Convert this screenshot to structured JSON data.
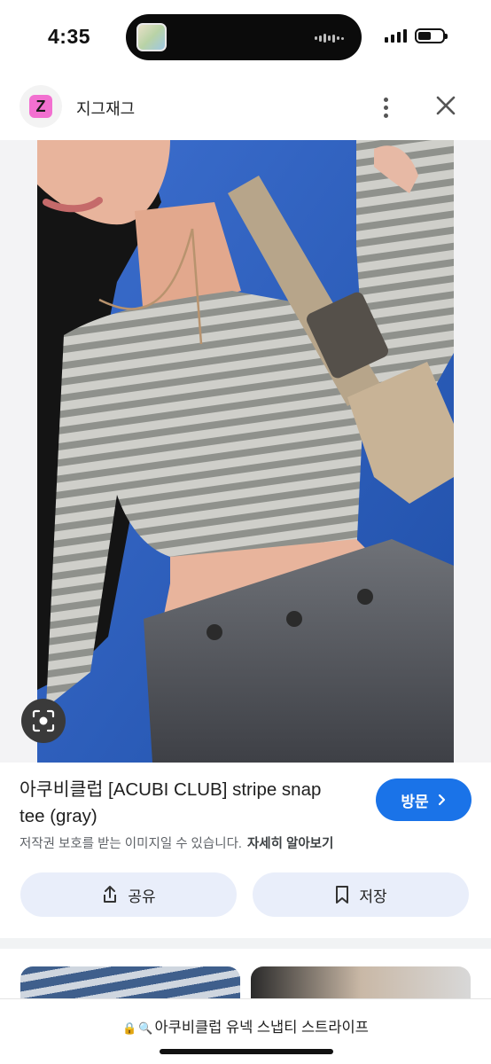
{
  "status": {
    "time": "4:35"
  },
  "header": {
    "site_logo_letter": "Z",
    "site_name": "지그재그"
  },
  "result": {
    "title": "아쿠비클럽 [ACUBI CLUB] stripe snap tee (gray)",
    "visit_label": "방문",
    "copyright_note": "저작권 보호를 받는 이미지일 수 있습니다.",
    "learn_more": "자세히 알아보기",
    "share_label": "공유",
    "save_label": "저장"
  },
  "url_bar": {
    "text": "아쿠비클럽 유넥 스냅티 스트라이프"
  },
  "colors": {
    "accent": "#1a73e8",
    "pill_bg": "#e9eefa",
    "logo_bg": "#f270d0"
  },
  "icons": [
    "search-lens-icon",
    "more-vert-icon",
    "close-icon",
    "chevron-right-icon",
    "share-icon",
    "bookmark-icon",
    "lock-icon",
    "search-icon"
  ]
}
